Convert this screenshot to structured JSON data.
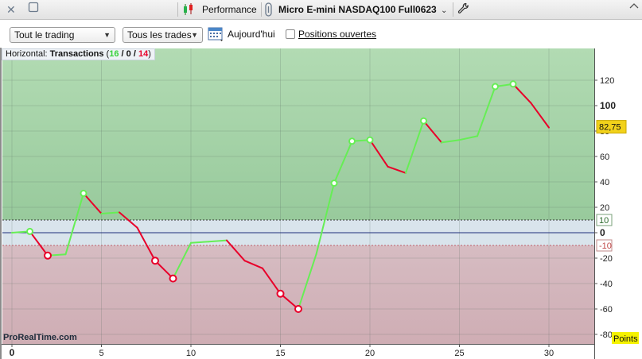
{
  "titlebar": {
    "close_icon": "close-icon",
    "restore_icon": "restore-icon",
    "tool_name": "Performance",
    "instrument": "Micro E-mini NASDAQ100 Full0623",
    "wrench_icon": "wrench-icon"
  },
  "toolbar": {
    "filter_scope": "Tout le trading",
    "filter_trades": "Tous les trades",
    "date_label": "Aujourd'hui",
    "open_positions_label": "Positions ouvertes"
  },
  "legend": {
    "prefix": "Horizontal:",
    "name": "Transactions",
    "open": " (",
    "wins": "16",
    "sep1": " / ",
    "neutral": "0",
    "sep2": " / ",
    "losses": "14",
    "close": ")"
  },
  "watermark": "ProRealTime.com",
  "colors": {
    "gain": "#22cc22",
    "gain_line": "#66ee55",
    "loss": "#e8002a",
    "profit_zone": "#a6d6a8",
    "loss_zone": "#d4b3ba",
    "neutral_zone": "#d9e4ec",
    "last_value_bg": "#f2d21b"
  },
  "chart_data": {
    "type": "line",
    "title": "",
    "xlabel": "",
    "ylabel": "Points",
    "xlim": [
      0,
      32
    ],
    "ylim": [
      -80,
      140
    ],
    "x_ticks": [
      0,
      5,
      10,
      15,
      20,
      25,
      30
    ],
    "y_ticks": [
      120,
      100,
      80,
      60,
      40,
      20,
      0,
      -20,
      -40,
      -60,
      -80
    ],
    "y_bold_ticks": [
      100,
      0
    ],
    "threshold_upper": 10,
    "threshold_lower": -10,
    "threshold_upper_label": "10",
    "threshold_lower_label": "-10",
    "last_value_label": "82,75",
    "last_value": 82.75,
    "points": [
      {
        "x": 0,
        "y": 0
      },
      {
        "x": 1,
        "y": 1
      },
      {
        "x": 2,
        "y": -18
      },
      {
        "x": 3,
        "y": -17
      },
      {
        "x": 4,
        "y": 31
      },
      {
        "x": 5,
        "y": 15
      },
      {
        "x": 6,
        "y": 16
      },
      {
        "x": 7,
        "y": 4
      },
      {
        "x": 8,
        "y": -22
      },
      {
        "x": 9,
        "y": -36
      },
      {
        "x": 10,
        "y": -8
      },
      {
        "x": 11,
        "y": -7
      },
      {
        "x": 12,
        "y": -6
      },
      {
        "x": 13,
        "y": -22
      },
      {
        "x": 14,
        "y": -28
      },
      {
        "x": 15,
        "y": -48
      },
      {
        "x": 16,
        "y": -60
      },
      {
        "x": 17,
        "y": -17
      },
      {
        "x": 18,
        "y": 39
      },
      {
        "x": 19,
        "y": 72
      },
      {
        "x": 20,
        "y": 73
      },
      {
        "x": 21,
        "y": 52
      },
      {
        "x": 22,
        "y": 47
      },
      {
        "x": 23,
        "y": 88
      },
      {
        "x": 24,
        "y": 71
      },
      {
        "x": 25,
        "y": 73
      },
      {
        "x": 26,
        "y": 76
      },
      {
        "x": 27,
        "y": 115
      },
      {
        "x": 28,
        "y": 117
      },
      {
        "x": 29,
        "y": 102
      },
      {
        "x": 30,
        "y": 82.75
      }
    ],
    "markers": [
      {
        "x": 1,
        "y": 1,
        "kind": "gain"
      },
      {
        "x": 2,
        "y": -18,
        "kind": "loss"
      },
      {
        "x": 4,
        "y": 31,
        "kind": "gain"
      },
      {
        "x": 8,
        "y": -22,
        "kind": "loss"
      },
      {
        "x": 9,
        "y": -36,
        "kind": "loss"
      },
      {
        "x": 15,
        "y": -48,
        "kind": "loss"
      },
      {
        "x": 16,
        "y": -60,
        "kind": "loss"
      },
      {
        "x": 18,
        "y": 39,
        "kind": "gain"
      },
      {
        "x": 19,
        "y": 72,
        "kind": "gain"
      },
      {
        "x": 20,
        "y": 73,
        "kind": "gain"
      },
      {
        "x": 23,
        "y": 88,
        "kind": "gain"
      },
      {
        "x": 27,
        "y": 115,
        "kind": "gain"
      },
      {
        "x": 28,
        "y": 117,
        "kind": "gain"
      }
    ]
  }
}
